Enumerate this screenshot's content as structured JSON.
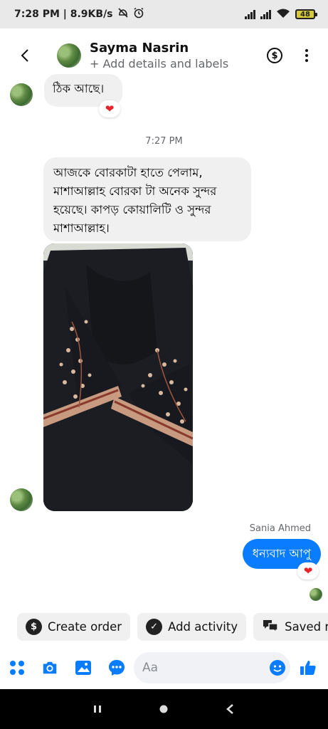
{
  "status_bar": {
    "time_speed": "7:28 PM | 8.9KB/s",
    "battery": "48"
  },
  "header": {
    "contact_name": "Sayma Nasrin",
    "subtitle": "+ Add details and labels"
  },
  "messages": {
    "first_text": "ঠিক আছে।",
    "first_reaction": "❤",
    "timestamp": "7:27 PM",
    "second_text": "আজকে বোরকাটা হাতে পেলাম, মাশাআল্লাহ বোরকা টা অনেক সুন্দর হয়েছে। কাপড় কোয়ালিটি ও সুন্দর মাশাআল্লাহ।",
    "reply_sender": "Sania Ahmed",
    "reply_text": "ধন্যবাদ আপু",
    "reply_reaction": "❤"
  },
  "actions": {
    "create_order": "Create order",
    "add_activity": "Add activity",
    "saved": "Saved r"
  },
  "composer": {
    "placeholder": "Aa"
  },
  "colors": {
    "accent": "#0a7cff",
    "heart": "#e5252a",
    "icon_blue": "#0a7cff"
  }
}
